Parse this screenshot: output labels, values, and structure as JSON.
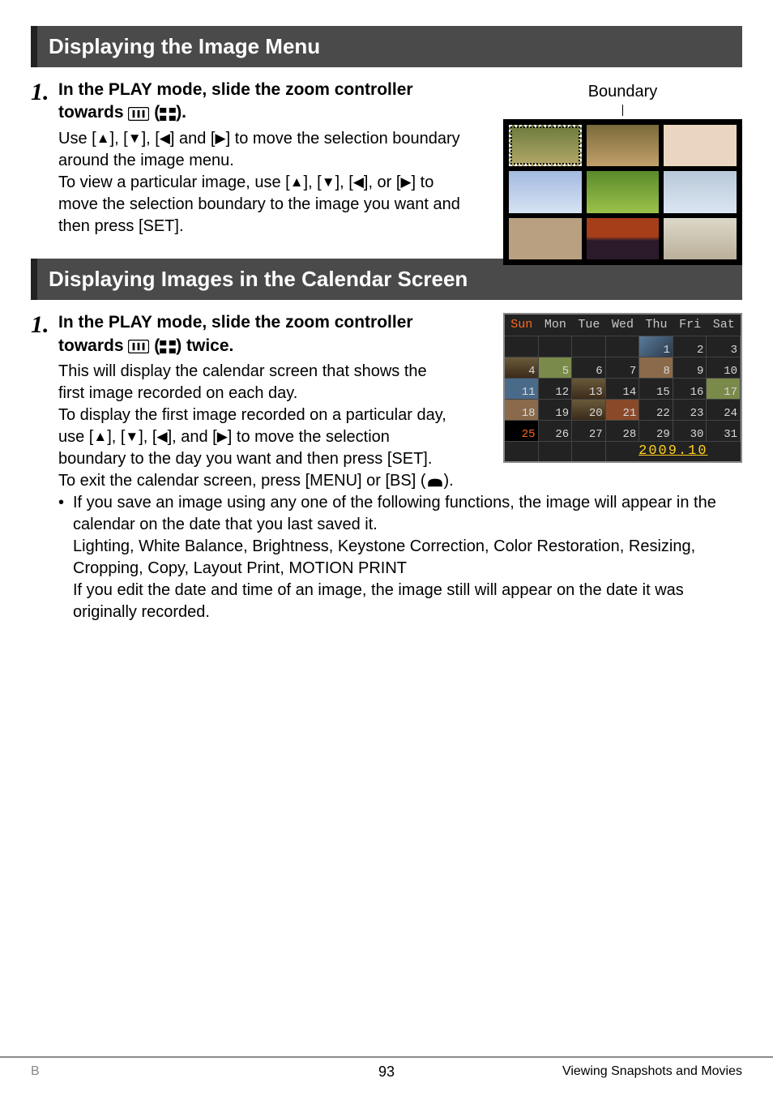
{
  "section1": {
    "heading": "Displaying the Image Menu",
    "step_num": "1.",
    "step_title_pre": "In the PLAY mode, slide the zoom controller towards ",
    "step_title_post": ").",
    "step_title_space": " (",
    "body1_pre": "Use [",
    "up": "▲",
    "sep": "], [",
    "down": "▼",
    "left": "◀",
    "body1_and": "] and [",
    "right": "▶",
    "body1_post": "] to move the selection boundary around the image menu.",
    "body2_pre": "To view a particular image, use [",
    "body2_or": "], or [",
    "body2_post": "] to move the selection boundary to the image you want and then press [SET].",
    "figure_label": "Boundary"
  },
  "section2": {
    "heading": "Displaying Images in the Calendar Screen",
    "step_num": "1.",
    "step_title_pre": "In the PLAY mode, slide the zoom controller towards ",
    "step_title_space": " (",
    "step_title_post": ") twice.",
    "body1": "This will display the calendar screen that shows the first image recorded on each day.",
    "body2_pre": "To display the first image recorded on a particular day, use [",
    "up": "▲",
    "down": "▼",
    "left": "◀",
    "right": "▶",
    "sep": "], [",
    "body2_and": "], and [",
    "body2_post": "] to move the selection boundary to the day you want and then press [SET].",
    "body3_pre": "To exit the calendar screen, press [MENU] or [BS] (",
    "body3_post": ").",
    "bullet1": "If you save an image using any one of the following functions, the image will appear in the calendar on the date that you last saved it.",
    "bullet2": "Lighting, White Balance, Brightness, Keystone Correction, Color Restoration, Resizing, Cropping, Copy, Layout Print, MOTION PRINT",
    "bullet3": "If you edit the date and time of an image, the image still will appear on the date it was originally recorded.",
    "calendar": {
      "days": [
        "Sun",
        "Mon",
        "Tue",
        "Wed",
        "Thu",
        "Fri",
        "Sat"
      ],
      "footer_date": "2009.10"
    }
  },
  "footer": {
    "left": "B",
    "page": "93",
    "right": "Viewing Snapshots and Movies"
  }
}
